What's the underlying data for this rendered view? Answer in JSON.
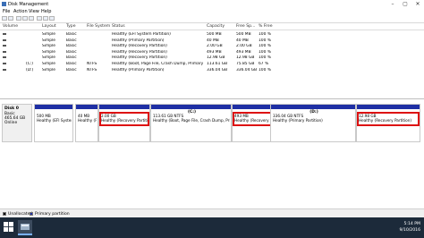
{
  "window": {
    "title": "Disk Management"
  },
  "menu": [
    "File",
    "Action",
    "View",
    "Help"
  ],
  "volume_columns": [
    "Volume",
    "Layout",
    "Type",
    "File System",
    "Status",
    "Capacity",
    "Free Sp...",
    "% Free"
  ],
  "volumes": [
    {
      "volume": "",
      "layout": "Simple",
      "type": "Basic",
      "fs": "",
      "status": "Healthy (EFI System Partition)",
      "capacity": "500 MB",
      "free": "500 MB",
      "pct": "100 %"
    },
    {
      "volume": "",
      "layout": "Simple",
      "type": "Basic",
      "fs": "",
      "status": "Healthy (Primary Partition)",
      "capacity": "40 MB",
      "free": "40 MB",
      "pct": "100 %"
    },
    {
      "volume": "",
      "layout": "Simple",
      "type": "Basic",
      "fs": "",
      "status": "Healthy (Recovery Partition)",
      "capacity": "2.00 GB",
      "free": "2.00 GB",
      "pct": "100 %"
    },
    {
      "volume": "",
      "layout": "Simple",
      "type": "Basic",
      "fs": "",
      "status": "Healthy (Recovery Partition)",
      "capacity": "493 MB",
      "free": "493 MB",
      "pct": "100 %"
    },
    {
      "volume": "",
      "layout": "Simple",
      "type": "Basic",
      "fs": "",
      "status": "Healthy (Recovery Partition)",
      "capacity": "12.98 GB",
      "free": "12.98 GB",
      "pct": "100 %"
    },
    {
      "volume": "(C:)",
      "layout": "Simple",
      "type": "Basic",
      "fs": "NTFS",
      "status": "Healthy (Boot, Page File, Crash Dump, Primary Partition)",
      "capacity": "113.61 GB",
      "free": "75.85 GB",
      "pct": "67 %"
    },
    {
      "volume": "(D:)",
      "layout": "Simple",
      "type": "Basic",
      "fs": "NTFS",
      "status": "Healthy (Primary Partition)",
      "capacity": "336.04 GB",
      "free": "336.04 GB",
      "pct": "100 %"
    }
  ],
  "disk": {
    "name": "Disk 0",
    "type": "Basic",
    "size": "465.64 GB",
    "state": "Online"
  },
  "partitions": [
    {
      "name": "",
      "size": "500 MB",
      "status": "Healthy (EFI System Pa"
    },
    {
      "name": "",
      "size": "40 MB",
      "status": "Healthy (F"
    },
    {
      "name": "",
      "size": "2.00 GB",
      "status": "Healthy (Recovery Partition)"
    },
    {
      "name": "(C:)",
      "size": "113.61 GB NTFS",
      "status": "Healthy (Boot, Page File, Crash Dump, Pri"
    },
    {
      "name": "",
      "size": "493 MB",
      "status": "Healthy (Recovery Partit"
    },
    {
      "name": "(D:)",
      "size": "336.04 GB NTFS",
      "status": "Healthy (Primary Partition)"
    },
    {
      "name": "",
      "size": "12.98 GB",
      "status": "Healthy (Recovery Partition)"
    }
  ],
  "legend": [
    "Unallocated",
    "Primary partition"
  ],
  "colors": {
    "unallocated": "#000000",
    "primary": "#1e2fa4",
    "highlight": "#dd1111"
  },
  "clock": {
    "time": "5:14 PM",
    "date": "9/10/2016"
  }
}
